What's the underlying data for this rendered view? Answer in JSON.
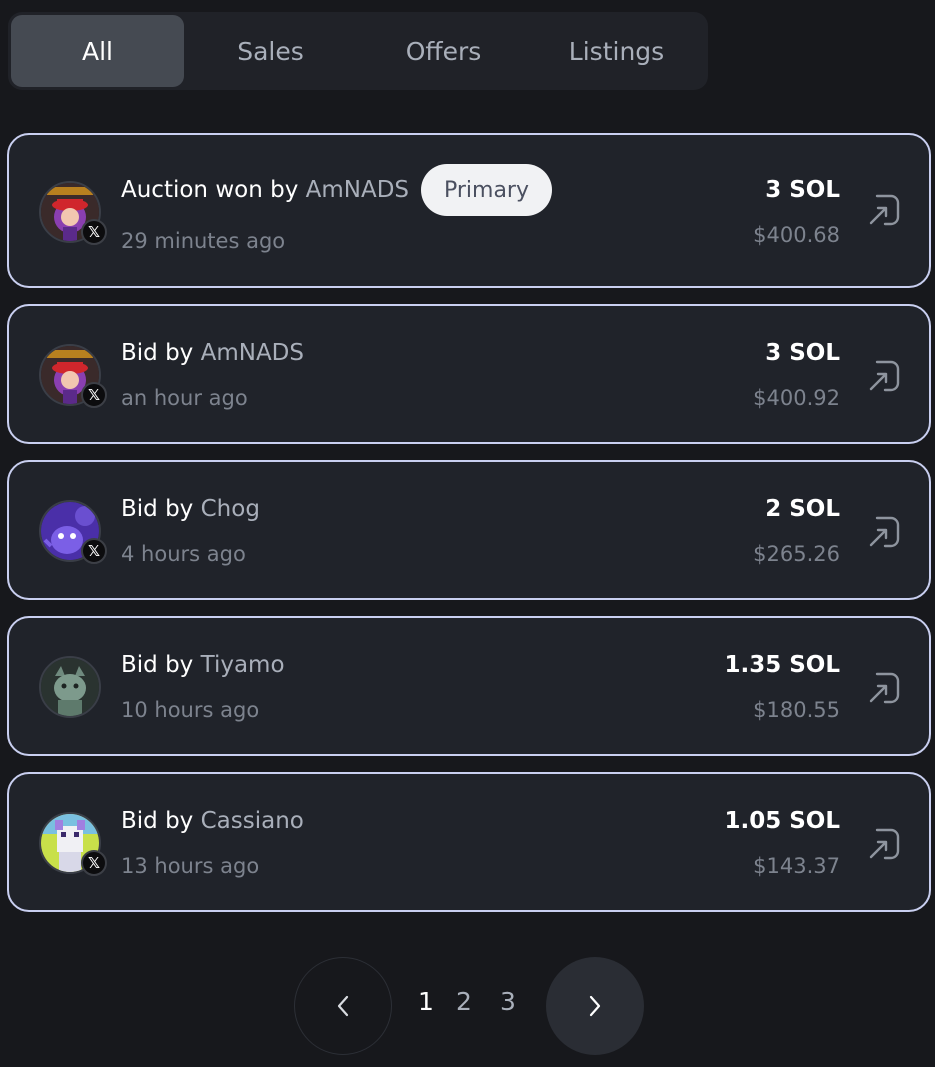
{
  "tabs": [
    {
      "label": "All",
      "active": true
    },
    {
      "label": "Sales",
      "active": false
    },
    {
      "label": "Offers",
      "active": false
    },
    {
      "label": "Listings",
      "active": false
    }
  ],
  "activities": [
    {
      "action": "Auction won by",
      "user": "AmNADS",
      "badge": "Primary",
      "time": "29 minutes ago",
      "sol": "3 SOL",
      "usd": "$400.68",
      "avatar": "red-hat-character-avatar",
      "social": "X"
    },
    {
      "action": "Bid by",
      "user": "AmNADS",
      "time": "an hour ago",
      "sol": "3 SOL",
      "usd": "$400.92",
      "avatar": "red-hat-character-avatar",
      "social": "X"
    },
    {
      "action": "Bid by",
      "user": "Chog",
      "time": "4 hours ago",
      "sol": "2 SOL",
      "usd": "$265.26",
      "avatar": "purple-creature-avatar",
      "social": "X"
    },
    {
      "action": "Bid by",
      "user": "Tiyamo",
      "time": "10 hours ago",
      "sol": "1.35 SOL",
      "usd": "$180.55",
      "avatar": "cat-sketch-avatar"
    },
    {
      "action": "Bid by",
      "user": "Cassiano",
      "time": "13 hours ago",
      "sol": "1.05 SOL",
      "usd": "$143.37",
      "avatar": "pixel-creature-avatar",
      "social": "X"
    }
  ],
  "pagination": {
    "pages": [
      "1",
      "2",
      "3"
    ],
    "current": "1",
    "prev_icon": "chevron-left-icon",
    "next_icon": "chevron-right-icon"
  },
  "colors": {
    "background": "#17181c",
    "card": "#20232a",
    "card_border": "#c9cff0",
    "muted_text": "#7d838e",
    "username_text": "#a9afba"
  }
}
